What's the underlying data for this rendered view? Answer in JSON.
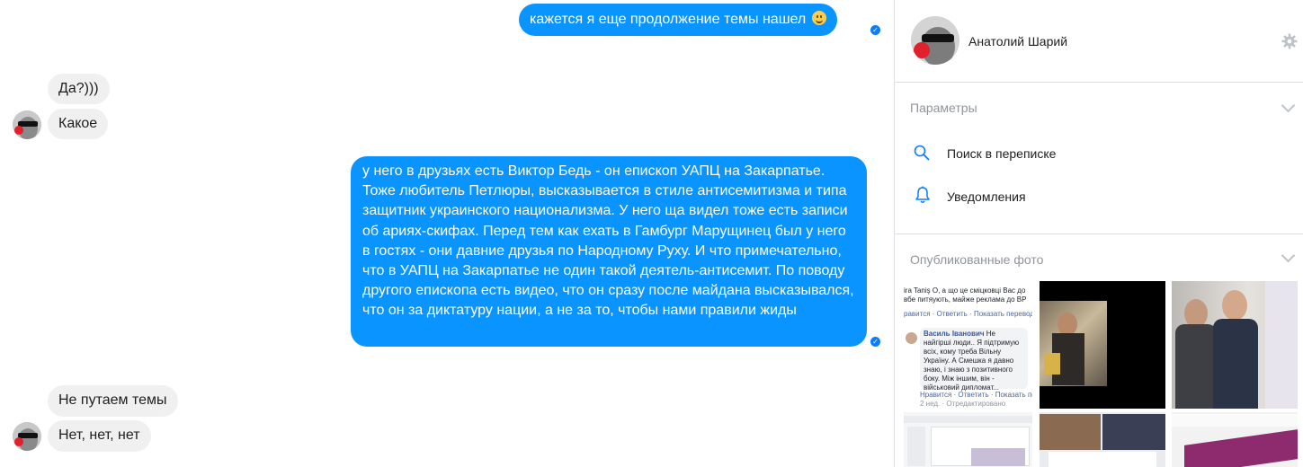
{
  "messages": {
    "m1": "кажется я еще продолжение темы нашел",
    "m2": "Да?)))",
    "m3": "Какое",
    "m4": "у него в друзьях есть Виктор Бедь - он епископ УАПЦ на Закарпатье. Тоже любитель Петлюры, высказывается в стиле антисемитизма и типа защитник украинского национализма. У него ща видел тоже есть записи об ариях-скифах. Перед тем как ехать в Гамбург Марущинец был у него в гостях - они давние друзья по Народному Руху. И что примечательно, что в УАПЦ на Закарпатье не один такой деятель-антисемит. По поводу другого епископа есть видео, что он сразу после майдана высказывался, что он за диктатуру нации, а не за то, чтобы нами правили жиды",
    "m5": "Не путаем темы",
    "m6": "Нет, нет, нет"
  },
  "panel": {
    "contact_name": "Анатолий Шарий",
    "options_title": "Параметры",
    "search_label": "Поиск в переписке",
    "notifications_label": "Уведомления",
    "photos_title": "Опубликованные фото"
  },
  "photos": {
    "p1": {
      "line1": "ira Taniş О, а що це сміцковці Вас до",
      "line2": "вбе питяують, майже реклама до ВР",
      "line3": "равится · Ответить · Показать перевод",
      "name": "Василь Іванович",
      "comment": "Не найгірші люди.. Я підтримую всіх, кому треба Вільну Україну. А Смешка я давно знаю, і знаю з позитивного боку. Між іншим, він - військовий дипломат...",
      "actions": "Нравится · Ответить · Показать перев",
      "time": "2 нед. · Отредактировано"
    }
  },
  "colors": {
    "outgoing": "#0a94ff",
    "incoming": "#f1f0f0",
    "accent": "#0a7cff"
  },
  "icons": {
    "settings": "gear-icon",
    "search": "search-icon",
    "bell": "bell-icon",
    "seen": "check-circle-icon"
  }
}
